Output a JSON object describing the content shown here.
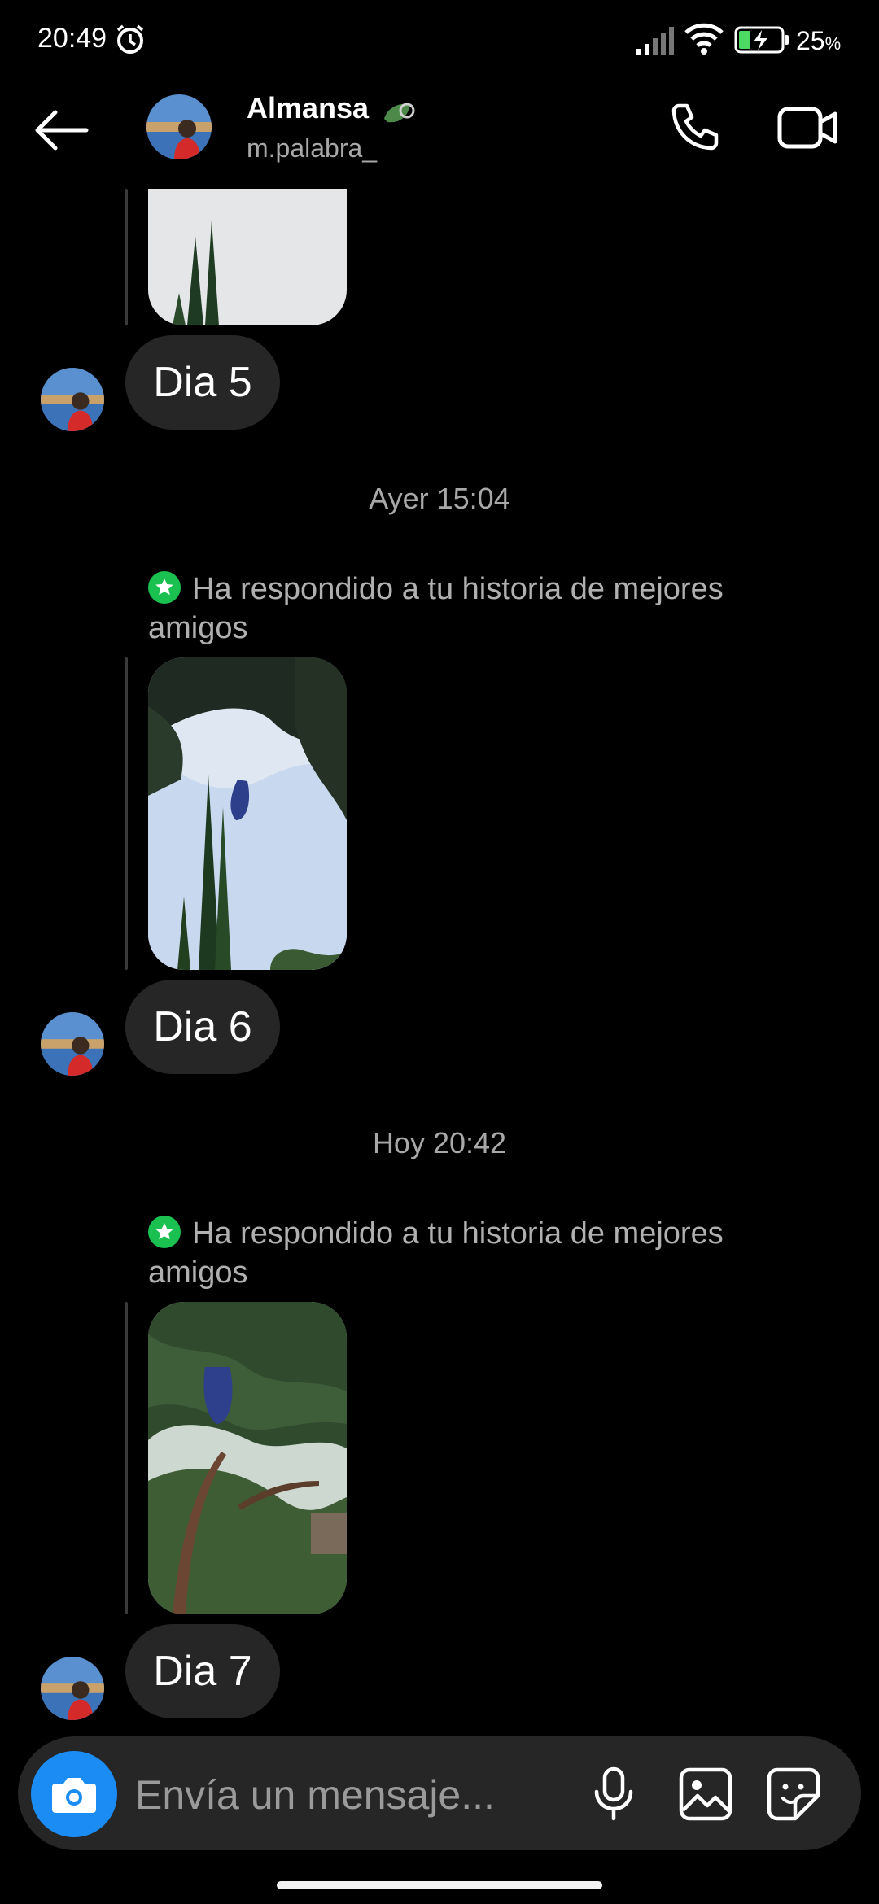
{
  "status_bar": {
    "time": "20:49",
    "battery_percent": "25",
    "battery_unit": "%",
    "icons": [
      "alarm-icon",
      "signal-icon",
      "wifi-icon",
      "battery-charging-icon"
    ]
  },
  "header": {
    "name": "Almansa",
    "username": "m.palabra_",
    "icons": [
      "back-arrow-icon",
      "leaf-icon",
      "phone-icon",
      "video-camera-icon"
    ]
  },
  "messages": [
    {
      "type": "story_image",
      "caption": ""
    },
    {
      "type": "text",
      "text": "Dia 5"
    },
    {
      "type": "timestamp",
      "text": "Ayer 15:04"
    },
    {
      "type": "reply_note",
      "text": "Ha respondido a tu historia de mejores amigos"
    },
    {
      "type": "story_image"
    },
    {
      "type": "text",
      "text": "Dia 6"
    },
    {
      "type": "timestamp",
      "text": "Hoy 20:42"
    },
    {
      "type": "reply_note",
      "text": "Ha respondido a tu historia de mejores amigos"
    },
    {
      "type": "story_image"
    },
    {
      "type": "text",
      "text": "Dia 7"
    }
  ],
  "composer": {
    "placeholder": "Envía un mensaje...",
    "icons": [
      "camera-icon",
      "microphone-icon",
      "gallery-icon",
      "sticker-icon"
    ]
  },
  "colors": {
    "background": "#000000",
    "bubble": "#262626",
    "accent_blue": "#1c8cf5",
    "close_friends_green": "#1ac050"
  }
}
